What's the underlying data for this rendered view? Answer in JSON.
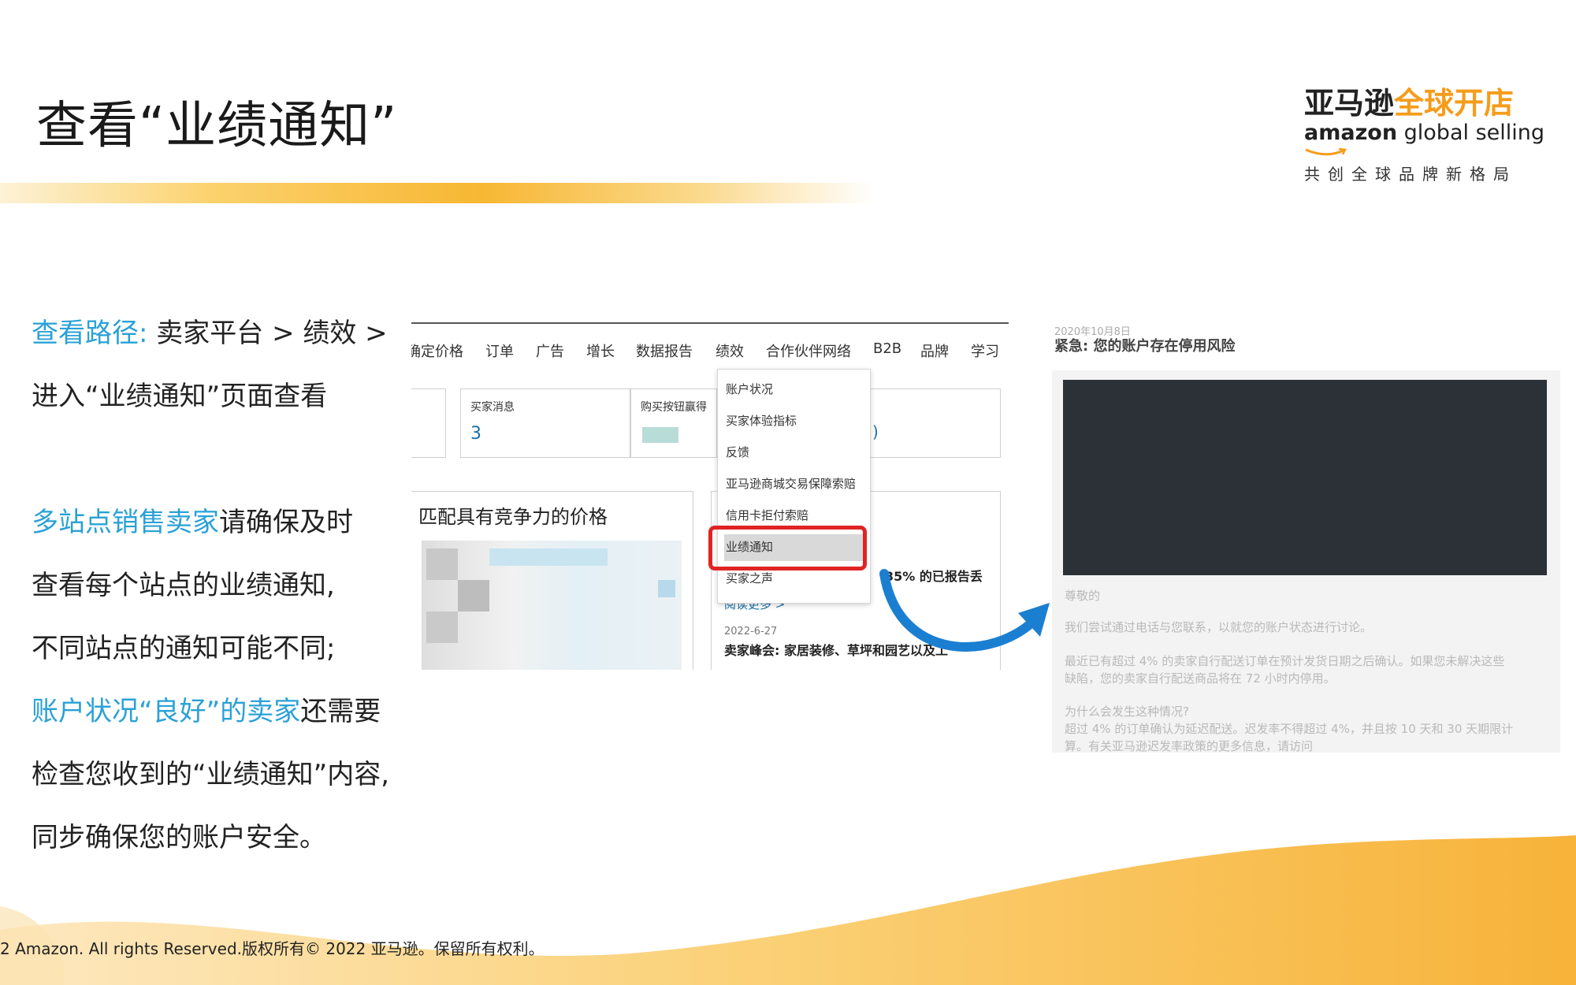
{
  "slide": {
    "title": "查看“业绩通知”",
    "logo": {
      "cn_dark": "亚马逊",
      "cn_orange": "全球开店",
      "en_bold": "amazon",
      "en_light": " global selling",
      "tagline": "共创全球品牌新格局"
    },
    "footer": "2 Amazon. All rights Reserved.版权所有© 2022 亚马逊。保留所有权利。"
  },
  "left_text": {
    "path_label": "查看路径:",
    "path_value": " 卖家平台 > 绩效 >",
    "path_line2": "进入“业绩通知”页面查看",
    "p1_blue": "多站点销售卖家",
    "p1_rest": "请确保及时",
    "p1_line2": "查看每个站点的业绩通知,",
    "p1_line3": "不同站点的通知可能不同;",
    "p2_blue": "账户状况“良好”的卖家",
    "p2_rest": "还需要",
    "p2_line2": "检查您收到的“业绩通知”内容,",
    "p2_line3": "同步确保您的账户安全。"
  },
  "seller_central": {
    "nav": [
      "确定价格",
      "订单",
      "广告",
      "增长",
      "数据报告",
      "绩效",
      "合作伙伴网络",
      "B2B",
      "品牌",
      "学习"
    ],
    "card_buyer_msgs": {
      "label": "买家消息",
      "value": "3"
    },
    "card_buybox": {
      "label": "购买按钮赢得"
    },
    "card_price": {
      "title": "匹配具有竞争力的价格"
    },
    "dropdown": [
      "账户状况",
      "买家体验指标",
      "反馈",
      "亚马逊商城交易保障索赔",
      "信用卡拒付索赔",
      "业绩通知",
      "买家之声"
    ],
    "news": {
      "stat": "35% 的已报告丢",
      "read_more": "阅读更多 >",
      "date": "2022-6-27",
      "headline": "卖家峰会: 家居装修、草坪和园艺以及工"
    }
  },
  "email": {
    "date": "2020年10月8日",
    "subject": "紧急: 您的账户存在停用风险",
    "greeting": "尊敬的",
    "body1": "我们尝试通过电话与您联系，以就您的账户状态进行讨论。",
    "body2a": "最近已有超过 4% 的卖家自行配送订单在预计发货日期之后确认。如果您未解决这些",
    "body2b": "缺陷，您的卖家自行配送商品将在 72 小时内停用。",
    "body3": "为什么会发生这种情况?",
    "body4a": "超过 4% 的订单确认为延迟配送。迟发率不得超过 4%，并且按 10 天和 30 天期限计",
    "body4b": "算。有关亚马逊迟发率政策的更多信息，请访问"
  },
  "colors": {
    "accent_blue": "#2aa1d6",
    "brand_orange": "#f59c1a",
    "highlight_red": "#e02424",
    "arrow_blue": "#1b7fd1"
  }
}
